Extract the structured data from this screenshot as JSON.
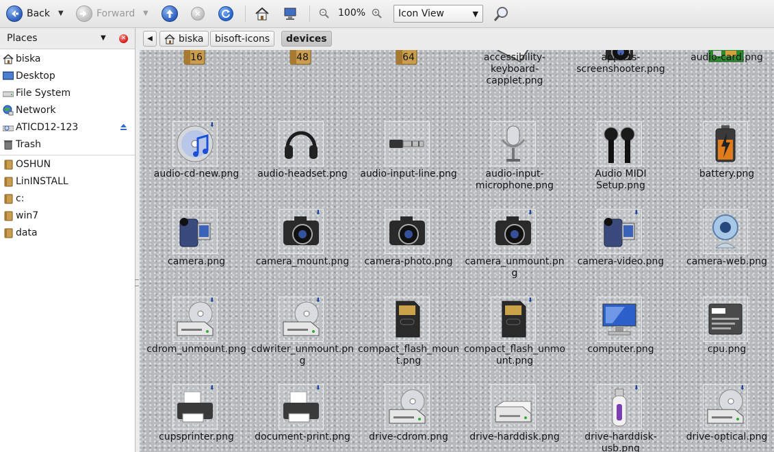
{
  "toolbar": {
    "back_label": "Back",
    "forward_label": "Forward",
    "zoom_level": "100%",
    "view_mode": "Icon View"
  },
  "sidebar": {
    "header_label": "Places",
    "items": [
      {
        "label": "biska",
        "icon": "home-icon"
      },
      {
        "label": "Desktop",
        "icon": "desktop-icon"
      },
      {
        "label": "File System",
        "icon": "drive-icon"
      },
      {
        "label": "Network",
        "icon": "network-icon"
      },
      {
        "label": "ATICD12-123",
        "icon": "drive-icon"
      },
      {
        "label": "Trash",
        "icon": "trash-icon"
      }
    ],
    "bookmarks": [
      {
        "label": "OSHUN",
        "icon": "folder-icon"
      },
      {
        "label": "LinINSTALL",
        "icon": "folder-icon"
      },
      {
        "label": "c:",
        "icon": "folder-icon"
      },
      {
        "label": "win7",
        "icon": "folder-icon"
      },
      {
        "label": "data",
        "icon": "folder-icon"
      }
    ]
  },
  "path": {
    "crumbs": [
      "biska",
      "bisoft-icons",
      "devices"
    ]
  },
  "files": [
    {
      "name": "16",
      "icon": "folder-icon"
    },
    {
      "name": "48",
      "icon": "folder-icon"
    },
    {
      "name": "64",
      "icon": "folder-icon"
    },
    {
      "name": "accessibility-keyboard-capplet.png",
      "icon": "keyboard-icon"
    },
    {
      "name": "applets-screenshooter.png",
      "icon": "camera-icon"
    },
    {
      "name": "audio-card.png",
      "icon": "audio-card-icon"
    },
    {
      "name": "audio-cd-new.png",
      "icon": "cd-icon"
    },
    {
      "name": "audio-headset.png",
      "icon": "headset-icon"
    },
    {
      "name": "audio-input-line.png",
      "icon": "audio-jack-icon"
    },
    {
      "name": "audio-input-microphone.png",
      "icon": "microphone-icon"
    },
    {
      "name": "Audio MIDI Setup.png",
      "icon": "midi-icon"
    },
    {
      "name": "battery.png",
      "icon": "battery-icon"
    },
    {
      "name": "camera.png",
      "icon": "camcorder-icon"
    },
    {
      "name": "camera_mount.png",
      "icon": "photo-camera-icon"
    },
    {
      "name": "camera-photo.png",
      "icon": "photo-camera-icon"
    },
    {
      "name": "camera_unmount.png",
      "icon": "photo-camera-icon"
    },
    {
      "name": "camera-video.png",
      "icon": "camcorder-icon"
    },
    {
      "name": "camera-web.png",
      "icon": "webcam-icon"
    },
    {
      "name": "cdrom_unmount.png",
      "icon": "optical-drive-icon"
    },
    {
      "name": "cdwriter_unmount.png",
      "icon": "optical-drive-icon"
    },
    {
      "name": "compact_flash_mount.png",
      "icon": "memory-card-icon"
    },
    {
      "name": "compact_flash_unmount.png",
      "icon": "memory-card-icon"
    },
    {
      "name": "computer.png",
      "icon": "computer-icon"
    },
    {
      "name": "cpu.png",
      "icon": "cpu-icon"
    },
    {
      "name": "cupsprinter.png",
      "icon": "printer-icon"
    },
    {
      "name": "document-print.png",
      "icon": "printer-icon"
    },
    {
      "name": "drive-cdrom.png",
      "icon": "optical-drive-icon"
    },
    {
      "name": "drive-harddisk.png",
      "icon": "harddisk-icon"
    },
    {
      "name": "drive-harddisk-usb.png",
      "icon": "usb-stick-icon"
    },
    {
      "name": "drive-optical.png",
      "icon": "optical-drive-icon"
    }
  ]
}
